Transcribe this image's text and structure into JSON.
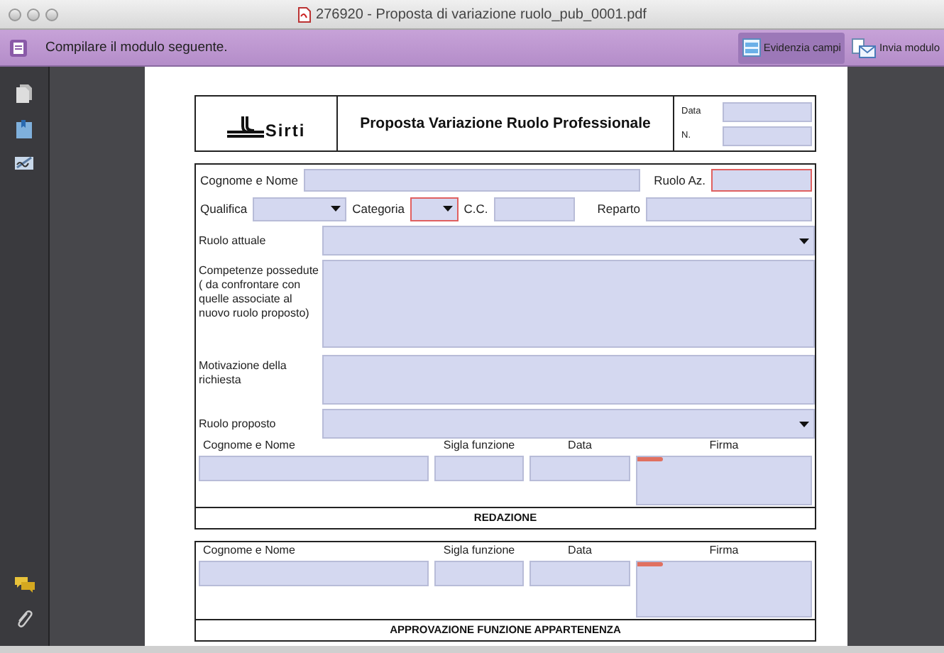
{
  "window": {
    "title": "276920 - Proposta di variazione ruolo_pub_0001.pdf"
  },
  "form_bar": {
    "message": "Compilare il modulo seguente.",
    "buttons": [
      {
        "label": "Evidenzia campi",
        "selected": true
      },
      {
        "label": "Invia modulo",
        "selected": false
      }
    ]
  },
  "side_tools": [
    {
      "kind": "pages"
    },
    {
      "kind": "bookmarks"
    },
    {
      "kind": "signatures"
    },
    {
      "kind": "comments"
    },
    {
      "kind": "attachments"
    }
  ],
  "header": {
    "logo_text": "Sirti",
    "title": "Proposta Variazione Ruolo Professionale",
    "fields": [
      {
        "label": "Data"
      },
      {
        "label": "N."
      }
    ]
  },
  "details": {
    "rows": [
      [
        {
          "label": "Cognome e Nome",
          "kind": "text",
          "required": false
        },
        {
          "label": "Ruolo Az.",
          "kind": "text",
          "required": true
        }
      ],
      [
        {
          "label": "Qualifica",
          "kind": "dropdown",
          "required": false
        },
        {
          "label": "Categoria",
          "kind": "dropdown",
          "required": true
        },
        {
          "label": "C.C.",
          "kind": "text",
          "required": false
        },
        {
          "label": "Reparto",
          "kind": "text",
          "required": false
        }
      ]
    ],
    "blocks": [
      {
        "label": "Ruolo attuale",
        "kind": "dropdown"
      },
      {
        "label": "Competenze possedute ( da confrontare con quelle associate al nuovo ruolo proposto)",
        "kind": "textarea"
      },
      {
        "label": "Motivazione della richiesta",
        "kind": "textarea"
      },
      {
        "label": "Ruolo proposto",
        "kind": "dropdown"
      }
    ],
    "signature": {
      "columns": [
        "Cognome e Nome",
        "Sigla funzione",
        "Data",
        "Firma"
      ],
      "footer": "REDAZIONE"
    }
  },
  "approval": {
    "columns": [
      "Cognome e Nome",
      "Sigla funzione",
      "Data",
      "Firma"
    ],
    "footer": "APPROVAZIONE FUNZIONE APPARTENENZA"
  }
}
